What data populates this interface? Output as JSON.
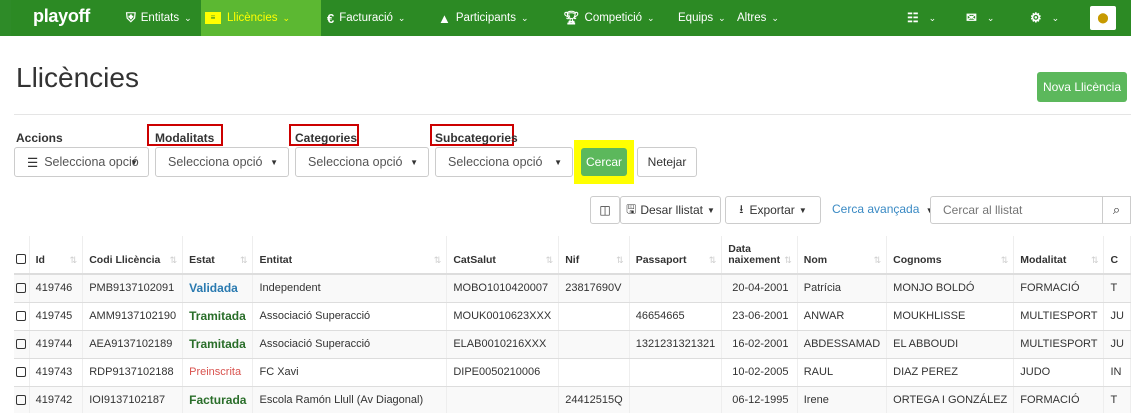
{
  "nav": {
    "brand": "playoff",
    "items": [
      {
        "label": "Entitats",
        "icon": "shield-icon"
      },
      {
        "label": "Llicències",
        "icon": "id-card-icon"
      },
      {
        "label": "Facturació",
        "icon": "euro-icon"
      },
      {
        "label": "Participants",
        "icon": "user-icon"
      },
      {
        "label": "Competició",
        "icon": "trophy-icon"
      },
      {
        "label": "Equips",
        "icon": ""
      },
      {
        "label": "Altres",
        "icon": ""
      }
    ],
    "right_icons": [
      "chart-icon",
      "envelope-icon",
      "gear-icon",
      "avatar"
    ],
    "caret": "⌄",
    "accent_color": "#2c8a24",
    "active_color": "#5cb832"
  },
  "page": {
    "title": "Llicències",
    "new_button": "Nova Llicència"
  },
  "filters": {
    "accions_label": "Accions",
    "accions_value": "Selecciona opció",
    "modalitats_label": "Modalitats",
    "modalitats_value": "Selecciona opció",
    "categories_label": "Categories",
    "categories_value": "Selecciona opció",
    "subcategories_label": "Subcategories",
    "subcategories_value": "Selecciona opció",
    "search_button": "Cercar",
    "clear_button": "Netejar"
  },
  "toolbar": {
    "save_list": "Desar llistat",
    "export": "Exportar",
    "advanced_search": "Cerca avançada",
    "search_placeholder": "Cercar al llistat"
  },
  "table": {
    "headers": [
      "Id",
      "Codi Llicència",
      "Estat",
      "Entitat",
      "CatSalut",
      "Nif",
      "Passaport",
      "Data naixement",
      "Nom",
      "Cognoms",
      "Modalitat",
      "C"
    ],
    "rows": [
      {
        "id": "419746",
        "codi": "PMB9137102091",
        "estat": "Validada",
        "estat_class": "st-validada",
        "entitat": "Independent",
        "catsalut": "MOBO1010420007",
        "nif": "23817690V",
        "passaport": "",
        "data": "20-04-2001",
        "nom": "Patrícia",
        "cognoms": "MONJO BOLDÓ",
        "modalitat": "FORMACIÓ",
        "c": "T"
      },
      {
        "id": "419745",
        "codi": "AMM9137102190",
        "estat": "Tramitada",
        "estat_class": "st-tramitada",
        "entitat": "Associació Superacció",
        "catsalut": "MOUK0010623XXX",
        "nif": "",
        "passaport": "46654665",
        "data": "23-06-2001",
        "nom": "ANWAR",
        "cognoms": "MOUKHLISSE",
        "modalitat": "MULTIESPORT",
        "c": "JU"
      },
      {
        "id": "419744",
        "codi": "AEA9137102189",
        "estat": "Tramitada",
        "estat_class": "st-tramitada",
        "entitat": "Associació Superacció",
        "catsalut": "ELAB0010216XXX",
        "nif": "",
        "passaport": "1321231321321",
        "data": "16-02-2001",
        "nom": "ABDESSAMAD",
        "cognoms": "EL ABBOUDI",
        "modalitat": "MULTIESPORT",
        "c": "JU"
      },
      {
        "id": "419743",
        "codi": "RDP9137102188",
        "estat": "Preinscrita",
        "estat_class": "st-preinscrita",
        "entitat": "FC Xavi",
        "catsalut": "DIPE0050210006",
        "nif": "",
        "passaport": "",
        "data": "10-02-2005",
        "nom": "RAUL",
        "cognoms": "DIAZ PEREZ",
        "modalitat": "JUDO",
        "c": "IN"
      },
      {
        "id": "419742",
        "codi": "IOI9137102187",
        "estat": "Facturada",
        "estat_class": "st-facturada",
        "entitat": "Escola Ramón Llull (Av Diagonal)",
        "catsalut": "",
        "nif": "24412515Q",
        "passaport": "",
        "data": "06-12-1995",
        "nom": "Irene",
        "cognoms": "ORTEGA I GONZÁLEZ",
        "modalitat": "FORMACIÓ",
        "c": "T"
      }
    ]
  }
}
